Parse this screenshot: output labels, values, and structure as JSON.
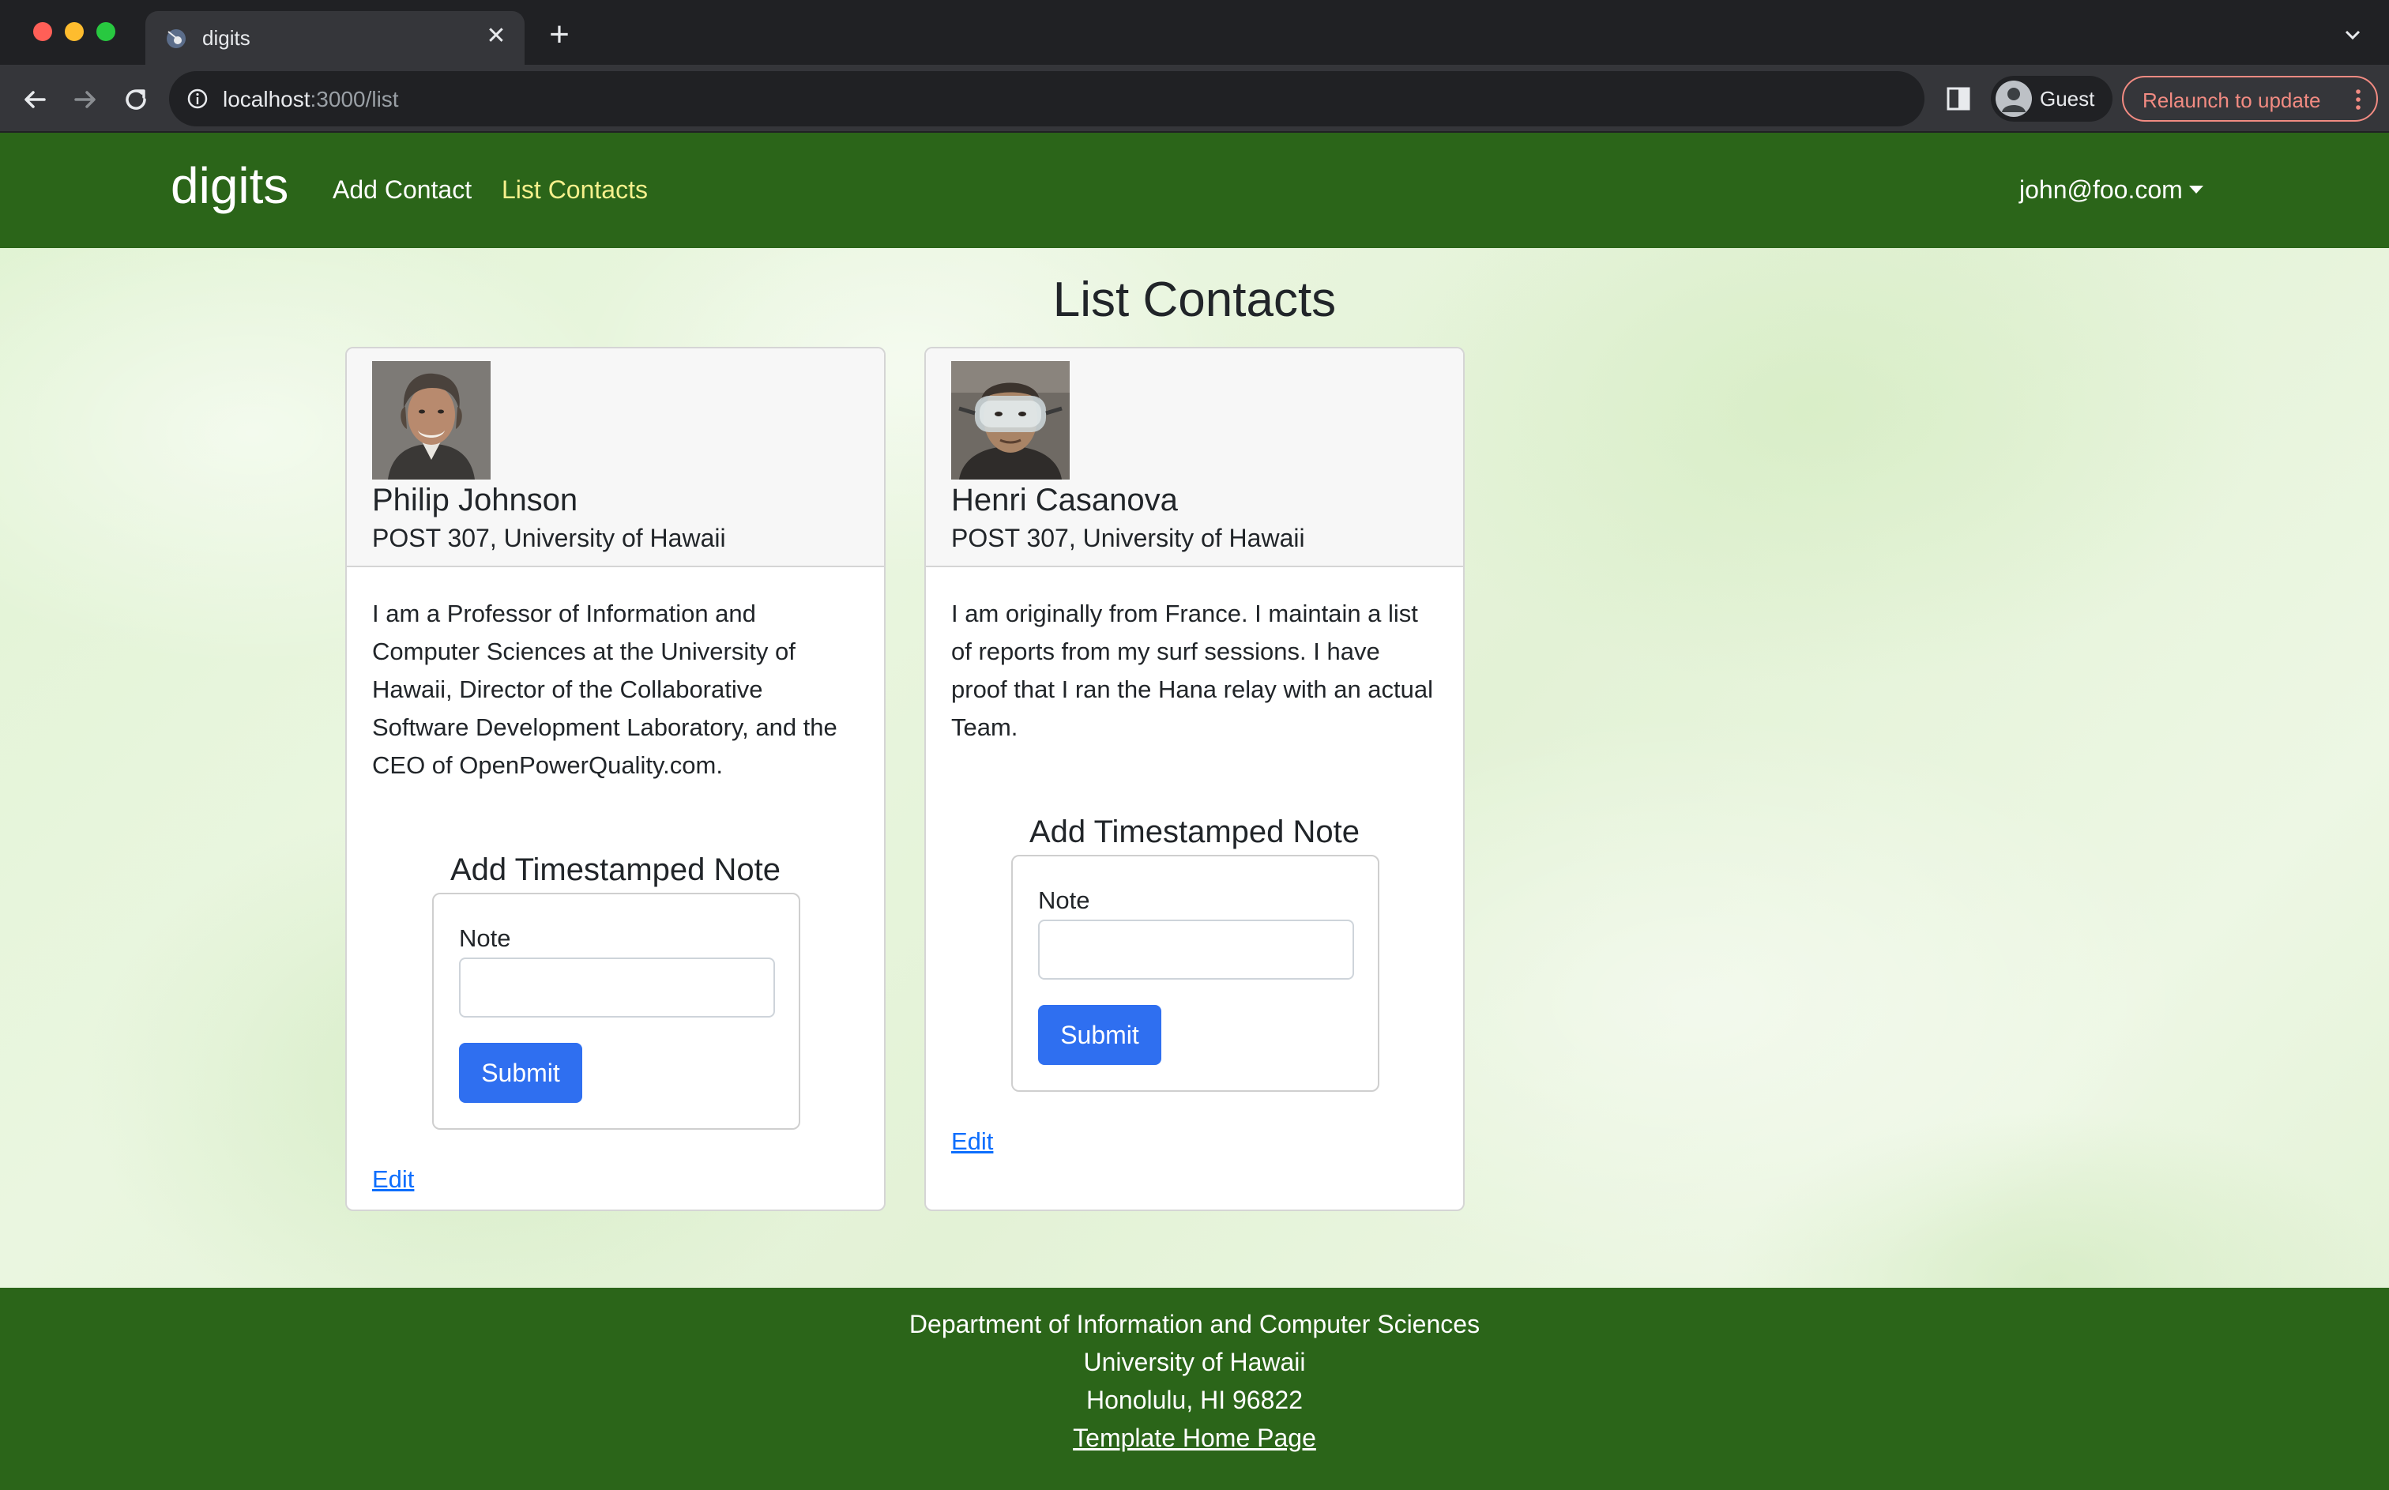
{
  "browser": {
    "tab_title": "digits",
    "url_host": "localhost",
    "url_path": ":3000/list",
    "profile_label": "Guest",
    "relaunch_label": "Relaunch to update"
  },
  "navbar": {
    "brand": "digits",
    "links": [
      "Add Contact",
      "List Contacts"
    ],
    "active_link": "List Contacts",
    "user": "john@foo.com"
  },
  "main": {
    "title": "List Contacts",
    "contacts": [
      {
        "name": "Philip Johnson",
        "address": "POST 307, University of Hawaii",
        "description": "I am a Professor of Information and Computer Sciences at the University of Hawaii, Director of the Collaborative Software Development Laboratory, and the CEO of OpenPowerQuality.com.",
        "note_heading": "Add Timestamped Note",
        "note_label": "Note",
        "note_value": "",
        "submit_label": "Submit",
        "edit_label": "Edit"
      },
      {
        "name": "Henri Casanova",
        "address": "POST 307, University of Hawaii",
        "description": "I am originally from France. I maintain a list of reports from my surf sessions. I have proof that I ran the Hana relay with an actual Team.",
        "note_heading": "Add Timestamped Note",
        "note_label": "Note",
        "note_value": "",
        "submit_label": "Submit",
        "edit_label": "Edit"
      }
    ]
  },
  "footer": {
    "lines": [
      "Department of Information and Computer Sciences",
      "University of Hawaii",
      "Honolulu, HI 96822"
    ],
    "link": "Template Home Page"
  },
  "colors": {
    "navbar_bg": "#2b6519",
    "active_link": "#f6f08c",
    "submit_bg": "#2f6ff0",
    "link": "#0d6efd",
    "relaunch": "#f28b82"
  }
}
